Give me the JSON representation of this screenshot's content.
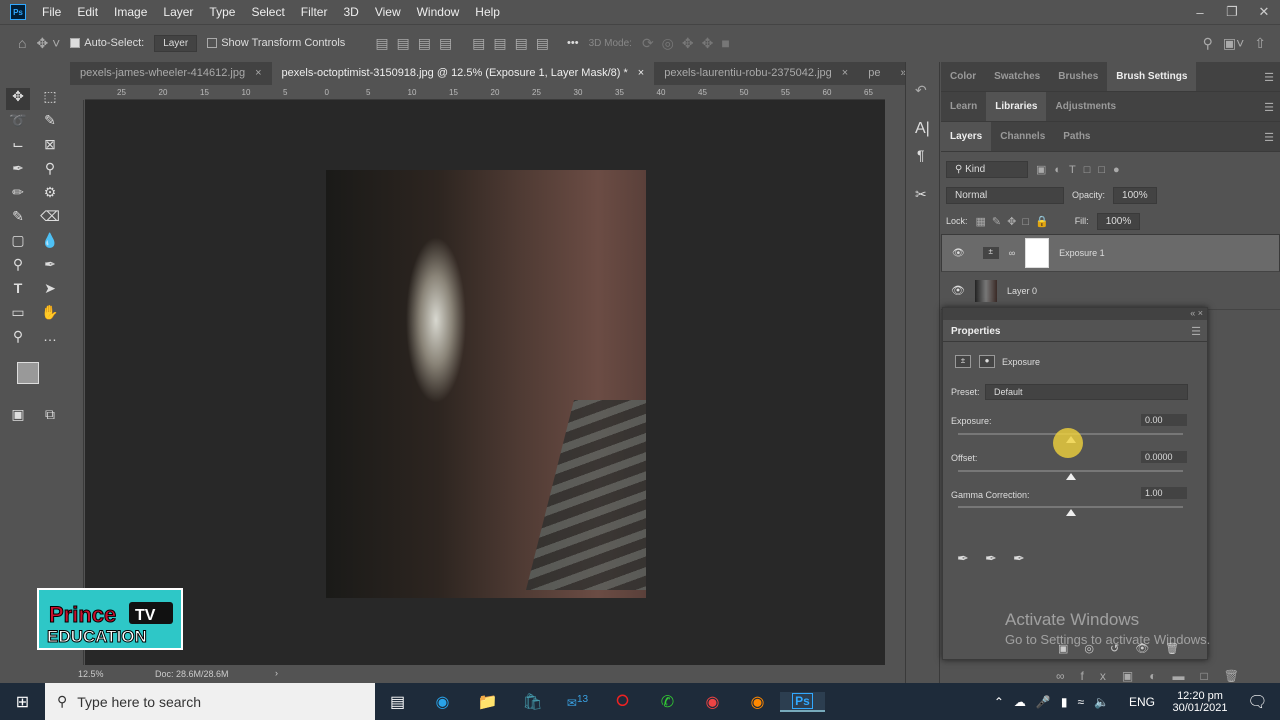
{
  "menu": {
    "items": [
      "File",
      "Edit",
      "Image",
      "Layer",
      "Type",
      "Select",
      "Filter",
      "3D",
      "View",
      "Window",
      "Help"
    ]
  },
  "options": {
    "auto_select": "Auto-Select:",
    "layer_select": "Layer",
    "show_transform": "Show Transform Controls",
    "more": "•••",
    "mode3d": "3D Mode:"
  },
  "tabs": [
    {
      "label": "pexels-james-wheeler-414612.jpg"
    },
    {
      "label": "pexels-octoptimist-3150918.jpg @ 12.5% (Exposure 1, Layer Mask/8) *"
    },
    {
      "label": "pexels-laurentiu-robu-2375042.jpg"
    },
    {
      "label": "pe"
    }
  ],
  "ruler": [
    "25",
    "20",
    "15",
    "10",
    "5",
    "0",
    "5",
    "10",
    "15",
    "20",
    "25",
    "30",
    "35",
    "40",
    "45",
    "50",
    "55",
    "60",
    "65"
  ],
  "status": {
    "zoom": "12.5%",
    "doc": "Doc: 28.6M/28.6M"
  },
  "logo": {
    "line1": "Prince",
    "line2": "TV",
    "line3": "EDUCATION"
  },
  "panels": {
    "row1": [
      "Color",
      "Swatches",
      "Brushes",
      "Brush Settings"
    ],
    "row2": [
      "Learn",
      "Libraries",
      "Adjustments"
    ],
    "row3": [
      "Layers",
      "Channels",
      "Paths"
    ],
    "kind": "Kind",
    "blend": "Normal",
    "opacity_label": "Opacity:",
    "opacity": "100%",
    "lock_label": "Lock:",
    "fill_label": "Fill:",
    "fill": "100%",
    "layers": [
      {
        "name": "Exposure 1"
      },
      {
        "name": "Layer 0"
      }
    ]
  },
  "properties": {
    "title": "Properties",
    "type": "Exposure",
    "preset_label": "Preset:",
    "preset": "Default",
    "exposure_label": "Exposure:",
    "exposure": "0.00",
    "exposure_frac": 0.5,
    "offset_label": "Offset:",
    "offset": "0.0000",
    "offset_frac": 0.5,
    "gamma_label": "Gamma Correction:",
    "gamma": "1.00",
    "gamma_frac": 0.5
  },
  "watermark": {
    "line1": "Activate Windows",
    "line2": "Go to Settings to activate Windows."
  },
  "taskbar": {
    "search": "Type here to search",
    "lang": "ENG",
    "time": "12:20 pm",
    "date": "30/01/2021",
    "mail_badge": "13"
  }
}
